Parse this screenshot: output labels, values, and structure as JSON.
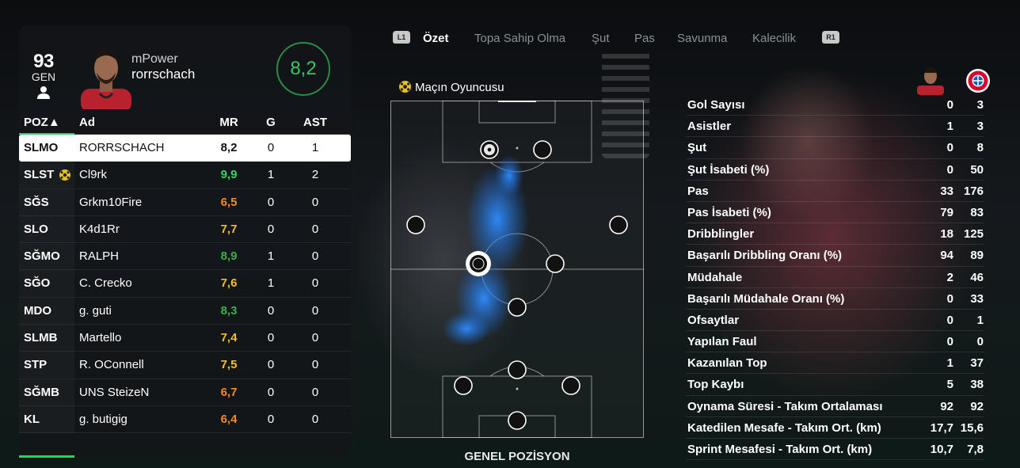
{
  "player": {
    "ovr_value": "93",
    "ovr_label": "GEN",
    "club": "mPower",
    "gamertag": "rorrschach",
    "match_rating": "8,2",
    "rating_color": "#37c76a"
  },
  "table": {
    "headers": {
      "pos": "POZ▲",
      "name": "Ad",
      "mr": "MR",
      "g": "G",
      "ast": "AST"
    },
    "rows": [
      {
        "pos": "SLMO",
        "name": "RORRSCHACH",
        "mr": "8,2",
        "g": "0",
        "ast": "1",
        "color": "none"
      },
      {
        "pos": "SLST",
        "name": "Cl9rk",
        "mr": "9,9",
        "g": "1",
        "ast": "2",
        "color": "green",
        "motm": true
      },
      {
        "pos": "SĞS",
        "name": "Grkm10Fire",
        "mr": "6,5",
        "g": "0",
        "ast": "0",
        "color": "orange"
      },
      {
        "pos": "SLO",
        "name": "K4d1Rr",
        "mr": "7,7",
        "g": "0",
        "ast": "0",
        "color": "yellow"
      },
      {
        "pos": "SĞMO",
        "name": "RALPH",
        "mr": "8,9",
        "g": "1",
        "ast": "0",
        "color": "dgreen"
      },
      {
        "pos": "SĞO",
        "name": "C. Crecko",
        "mr": "7,6",
        "g": "1",
        "ast": "0",
        "color": "yellow"
      },
      {
        "pos": "MDO",
        "name": "g. guti",
        "mr": "8,3",
        "g": "0",
        "ast": "0",
        "color": "dgreen"
      },
      {
        "pos": "SLMB",
        "name": "Martello",
        "mr": "7,4",
        "g": "0",
        "ast": "0",
        "color": "yellow"
      },
      {
        "pos": "STP",
        "name": "R. OConnell",
        "mr": "7,5",
        "g": "0",
        "ast": "0",
        "color": "yellow"
      },
      {
        "pos": "SĞMB",
        "name": "UNS SteizeN",
        "mr": "6,7",
        "g": "0",
        "ast": "0",
        "color": "orange"
      },
      {
        "pos": "KL",
        "name": "g. butigig",
        "mr": "6,4",
        "g": "0",
        "ast": "0",
        "color": "orange"
      }
    ]
  },
  "tabs": {
    "left_bumper": "L1",
    "right_bumper": "R1",
    "items": [
      "Özet",
      "Topa Sahip Olma",
      "Şut",
      "Pas",
      "Savunma",
      "Kalecilik"
    ],
    "active": 0
  },
  "pitch": {
    "motm_label": "Maçın Oyuncusu",
    "caption": "GENEL POZİSYON"
  },
  "stats": [
    {
      "label": "Gol Sayısı",
      "player": "0",
      "team": "3"
    },
    {
      "label": "Asistler",
      "player": "1",
      "team": "3"
    },
    {
      "label": "Şut",
      "player": "0",
      "team": "8"
    },
    {
      "label": "Şut İsabeti (%)",
      "player": "0",
      "team": "50"
    },
    {
      "label": "Pas",
      "player": "33",
      "team": "176"
    },
    {
      "label": "Pas İsabeti (%)",
      "player": "79",
      "team": "83"
    },
    {
      "label": "Dribblingler",
      "player": "18",
      "team": "125"
    },
    {
      "label": "Başarılı Dribbling Oranı (%)",
      "player": "94",
      "team": "89"
    },
    {
      "label": "Müdahale",
      "player": "2",
      "team": "46"
    },
    {
      "label": "Başarılı Müdahale Oranı (%)",
      "player": "0",
      "team": "33"
    },
    {
      "label": "Ofsaytlar",
      "player": "0",
      "team": "1"
    },
    {
      "label": "Yapılan Faul",
      "player": "0",
      "team": "0"
    },
    {
      "label": "Kazanılan Top",
      "player": "1",
      "team": "37"
    },
    {
      "label": "Top Kaybı",
      "player": "5",
      "team": "38"
    },
    {
      "label": "Oynama Süresi - Takım Ortalaması",
      "player": "92",
      "team": "92"
    },
    {
      "label": "Katedilen Mesafe - Takım Ort. (km)",
      "player": "17,7",
      "team": "15,6"
    },
    {
      "label": "Sprint Mesafesi - Takım Ort. (km)",
      "player": "10,7",
      "team": "7,8"
    }
  ]
}
